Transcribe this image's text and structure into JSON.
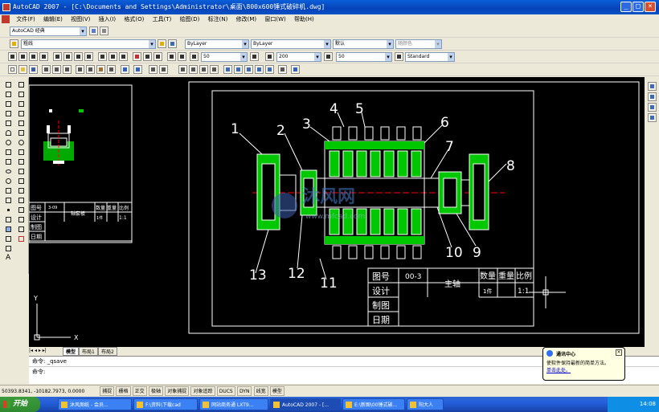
{
  "window": {
    "title": "AutoCAD 2007 - [C:\\Documents and Settings\\Administrator\\桌面\\800x600锤式破碎机.dwg]"
  },
  "menu": [
    "文件(F)",
    "编辑(E)",
    "视图(V)",
    "插入(I)",
    "格式(O)",
    "工具(T)",
    "绘图(D)",
    "标注(N)",
    "修改(M)",
    "窗口(W)",
    "帮助(H)"
  ],
  "toolbar": {
    "workspace": "AutoCAD 经典",
    "layer": "粗线",
    "color": "ByLayer",
    "linetype": "ByLayer",
    "lineweight": "默认",
    "plotstyle": "随颜色",
    "textstyle_size": "50",
    "dimscale": "200",
    "text_height": "50",
    "table_style": "Standard"
  },
  "drawing": {
    "part_labels": [
      "1",
      "2",
      "3",
      "4",
      "5",
      "6",
      "7",
      "8",
      "9",
      "10",
      "11",
      "12",
      "13"
    ],
    "title_block": {
      "label_tuhao": "图号",
      "drawing_no": "00-3",
      "part_name": "主轴",
      "label_qty": "数量",
      "label_weight": "重量",
      "label_scale": "比例",
      "qty": "1件",
      "scale": "1:1",
      "label_design": "设计",
      "label_draw": "制图",
      "label_date": "日期"
    },
    "small_title_block": {
      "label_tuhao": "图号",
      "drawing_no": "3-09",
      "part_name": "轴套板",
      "label_qty": "数量",
      "label_weight": "重量",
      "label_scale": "比例",
      "qty": "1件",
      "scale": "1:1",
      "label_design": "设计",
      "label_draw": "制图",
      "label_date": "日期"
    },
    "watermark": "沐风网",
    "watermark_url": "www.mfcad.com",
    "ucs_x": "X",
    "ucs_y": "Y"
  },
  "tabs": [
    "模型",
    "布局1",
    "布局2"
  ],
  "command_lines": [
    "命令: _qsave",
    "命令:"
  ],
  "status": {
    "coords": "50393.8341, -10182.7973, 0.0000",
    "toggles": [
      "捕捉",
      "栅格",
      "正交",
      "极轴",
      "对象捕捉",
      "对象追踪",
      "DUCS",
      "DYN",
      "线宽",
      "模型"
    ]
  },
  "balloon": {
    "title": "通讯中心",
    "message": "使软件保持最新的简单方法。",
    "link": "单击此处。"
  },
  "taskbar": {
    "start": "开始",
    "tasks": [
      "沐风图纸 - 会员...",
      "F:\\资料\\下载cad",
      "网站商务通 LXT9...",
      "AutoCAD 2007 - [...",
      "E:\\新图\\00锤式破...",
      "阳大人"
    ],
    "clock": "14:08"
  },
  "colors": {
    "canvas_bg": "#000000",
    "titlebar": "#0a52c8",
    "cad_green": "#00c800",
    "cad_white": "#ffffff",
    "cad_red": "#ff0000"
  }
}
